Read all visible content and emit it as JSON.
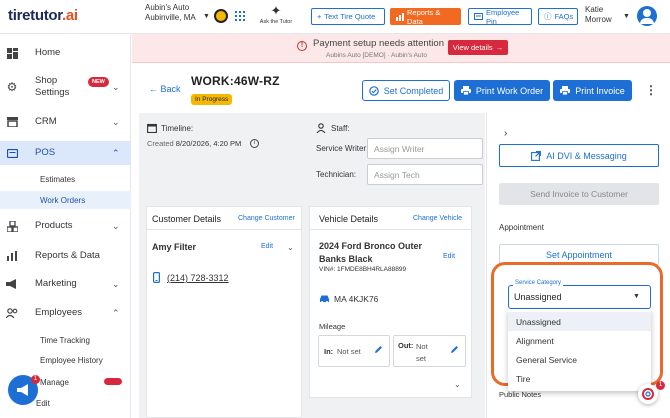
{
  "colors": {
    "brand_blue": "#1d6fd6",
    "accent_orange": "#f26a21",
    "alert_red": "#d6293e",
    "status_yellow": "#f5b800",
    "callout_orange": "#ea6a2b"
  },
  "topbar": {
    "logo_main": "tiretutor",
    "logo_accent": ".ai",
    "shop_name": "Aubin's Auto Aubinville, MA",
    "ask_tutor": "Ask the Tutor",
    "text_tire_quote": "Text Tire Quote",
    "reports_data": "Reports & Data",
    "employee_pin": "Employee Pin",
    "faqs": "FAQs",
    "user_name": "Katie Morrow"
  },
  "sidebar": {
    "home": "Home",
    "shop_settings": "Shop Settings",
    "new_badge": "NEW",
    "crm": "CRM",
    "pos": "POS",
    "estimates": "Estimates",
    "work_orders": "Work Orders",
    "products": "Products",
    "reports": "Reports & Data",
    "marketing": "Marketing",
    "employees": "Employees",
    "time_tracking": "Time Tracking",
    "employee_history": "Employee History",
    "manage": "Manage",
    "edit": "Edit",
    "fab_badge": "1"
  },
  "alert": {
    "title": "Payment setup needs attention",
    "subtitle": "Aubins Auto [DEMO] · Aubin's Auto",
    "button": "View details"
  },
  "header": {
    "back": "Back",
    "title": "WORK:46W-RZ",
    "status": "In Progress",
    "set_completed": "Set Completed",
    "print_work_order": "Print Work Order",
    "print_invoice": "Print Invoice"
  },
  "info": {
    "timeline_label": "Timeline:",
    "created_label": "Created",
    "created_value": "8/20/2026, 4:20 PM",
    "staff_label": "Staff:",
    "service_writer_label": "Service Writer:",
    "service_writer_placeholder": "Assign Writer",
    "technician_label": "Technician:",
    "technician_placeholder": "Assign Tech"
  },
  "customer": {
    "title": "Customer Details",
    "change": "Change Customer",
    "name": "Amy Filter",
    "edit": "Edit",
    "phone": "(214) 728-3312"
  },
  "vehicle": {
    "title": "Vehicle Details",
    "change": "Change Vehicle",
    "name": "2024 Ford Bronco Outer Banks Black",
    "edit": "Edit",
    "vin": "VIN#: 1FMDE8BH4RLA88899",
    "plate": "MA 4KJK76",
    "mileage_label": "Mileage",
    "in_label": "In:",
    "in_value": "Not set",
    "out_label": "Out:",
    "out_value": "Not set"
  },
  "right": {
    "ai_dvi": "AI DVI & Messaging",
    "send_invoice": "Send Invoice to Customer",
    "appointment_label": "Appointment",
    "set_appointment": "Set Appointment",
    "service_category_label": "Service Category",
    "service_category_value": "Unassigned",
    "options": [
      "Unassigned",
      "Alignment",
      "General Service",
      "Tire"
    ],
    "public_notes": "Public Notes",
    "help_badge": "1"
  }
}
